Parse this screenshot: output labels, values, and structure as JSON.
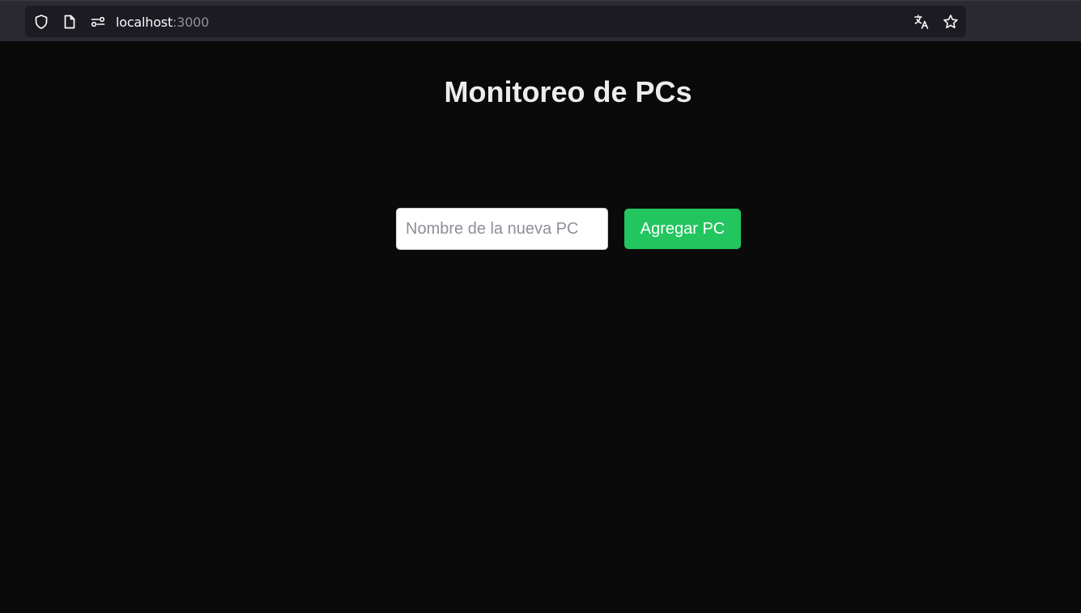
{
  "browser": {
    "url_host": "localhost",
    "url_port": ":3000",
    "icons": [
      "shield-icon",
      "page-icon",
      "permissions-icon",
      "translate-icon",
      "bookmark-star-icon"
    ]
  },
  "main": {
    "title": "Monitoreo de PCs",
    "input_placeholder": "Nombre de la nueva PC",
    "input_value": "",
    "add_button_label": "Agregar PC"
  },
  "colors": {
    "page_background": "#0a0a0a",
    "title_text": "#ededed",
    "button_background": "#22c55e",
    "button_text": "#ffffff",
    "input_background": "#ffffff"
  }
}
